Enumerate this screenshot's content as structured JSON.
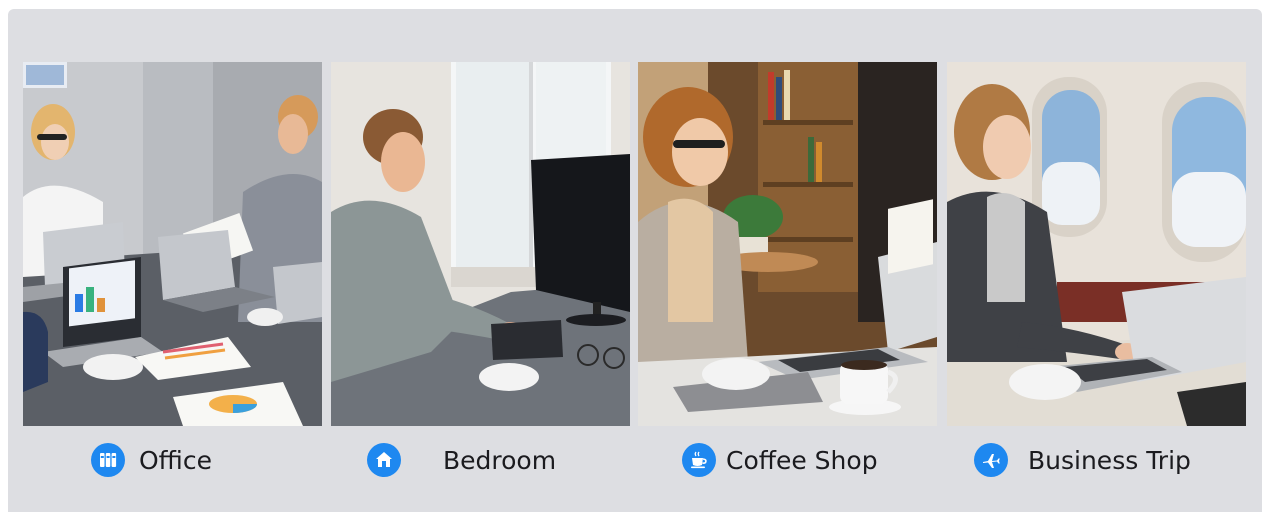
{
  "scenes": [
    {
      "label": "Office",
      "icon": "binders-icon"
    },
    {
      "label": "Bedroom",
      "icon": "home-icon"
    },
    {
      "label": "Coffee Shop",
      "icon": "coffee-cup-icon"
    },
    {
      "label": "Business Trip",
      "icon": "airplane-icon"
    }
  ],
  "colors": {
    "accent": "#1e88f0",
    "panel": "#dddee2",
    "text": "#1b1b1f"
  }
}
